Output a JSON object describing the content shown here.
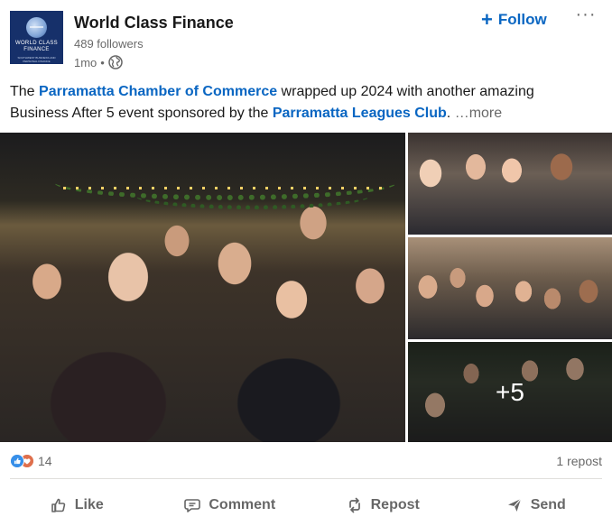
{
  "header": {
    "logo_text": "WORLD CLASS FINANCE",
    "logo_tagline": "SOUTHWEST BUSINESS AND PERSONAL FINANCE",
    "company_name": "World Class Finance",
    "followers": "489 followers",
    "time_ago": "1mo",
    "separator": "•",
    "visibility_icon": "globe-icon",
    "follow_label": "Follow",
    "follow_icon": "plus-icon",
    "more_icon": "more-dots-icon",
    "more_glyph": "···"
  },
  "post": {
    "text_part1": "The ",
    "link1": "Parramatta Chamber of Commerce",
    "text_part2": " wrapped up 2024 with another amazing Business After 5 event sponsored by the ",
    "link2": "Parramatta Leagues Club",
    "text_part3": ". ",
    "see_more": "…more"
  },
  "photos": {
    "extra_count": "+5"
  },
  "social": {
    "reaction_icons": [
      "like-icon",
      "love-icon"
    ],
    "reaction_count": "14",
    "reposts": "1 repost"
  },
  "actions": [
    {
      "label": "Like",
      "icon": "thumbs-up-icon"
    },
    {
      "label": "Comment",
      "icon": "comment-icon"
    },
    {
      "label": "Repost",
      "icon": "repost-icon"
    },
    {
      "label": "Send",
      "icon": "send-icon"
    }
  ],
  "colors": {
    "link": "#0a66c2",
    "muted_text": "#666666",
    "like_reaction": "#378fe9",
    "love_reaction": "#df704d"
  }
}
